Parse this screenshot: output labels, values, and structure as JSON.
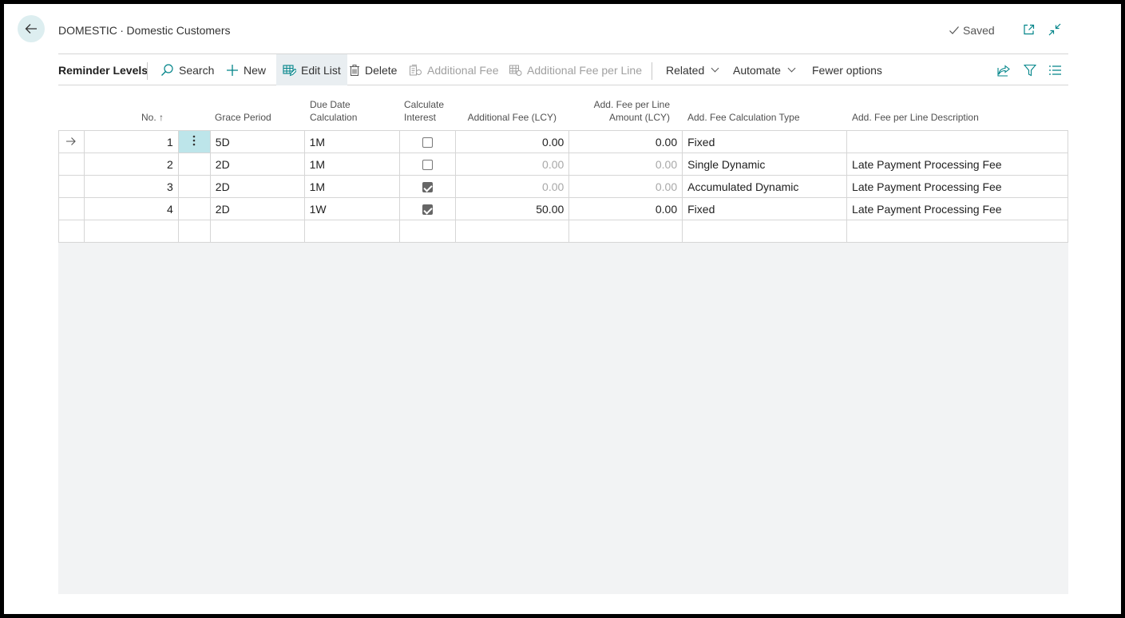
{
  "header": {
    "title": "DOMESTIC ∙ Domestic Customers",
    "saved_label": "Saved"
  },
  "actionbar": {
    "page_label": "Reminder Levels",
    "search": "Search",
    "new": "New",
    "edit_list": "Edit List",
    "delete": "Delete",
    "additional_fee": "Additional Fee",
    "additional_fee_per_line": "Additional Fee per Line",
    "related": "Related",
    "automate": "Automate",
    "fewer_options": "Fewer options"
  },
  "columns": {
    "no": "No. ↑",
    "grace_line1": "Grace Period",
    "due_line1": "Due Date",
    "due_line2": "Calculation",
    "calc_line1": "Calculate",
    "calc_line2": "Interest",
    "addfee": "Additional Fee (LCY)",
    "perline_line1": "Add. Fee per Line",
    "perline_line2": "Amount (LCY)",
    "calctype": "Add. Fee Calculation Type",
    "desc": "Add. Fee per Line Description"
  },
  "rows": [
    {
      "no": "1",
      "grace": "5D",
      "due": "1M",
      "interest": false,
      "addfee": "0.00",
      "perline": "0.00",
      "type": "Fixed",
      "desc": ""
    },
    {
      "no": "2",
      "grace": "2D",
      "due": "1M",
      "interest": false,
      "addfee": "0.00",
      "perline": "0.00",
      "type": "Single Dynamic",
      "desc": "Late Payment Processing Fee"
    },
    {
      "no": "3",
      "grace": "2D",
      "due": "1M",
      "interest": true,
      "addfee": "0.00",
      "perline": "0.00",
      "type": "Accumulated Dynamic",
      "desc": "Late Payment Processing Fee"
    },
    {
      "no": "4",
      "grace": "2D",
      "due": "1W",
      "interest": true,
      "addfee": "50.00",
      "perline": "0.00",
      "type": "Fixed",
      "desc": "Late Payment Processing Fee"
    }
  ],
  "icons": {
    "back": "arrow-left-icon",
    "saved": "checkmark-icon",
    "open_new": "open-in-new-window-icon",
    "collapse": "collapse-icon",
    "search": "search-icon",
    "new": "plus-icon",
    "edit_list": "edit-list-icon",
    "delete": "trash-icon",
    "share": "share-icon",
    "filter": "filter-icon",
    "list": "list-view-icon",
    "row_arrow": "arrow-right-icon",
    "row_menu": "more-vertical-icon"
  },
  "colors": {
    "accent": "#008489",
    "selected_cell": "#bde5ea",
    "back_button": "#ddeef0",
    "grid_bg": "#f2f3f4"
  }
}
